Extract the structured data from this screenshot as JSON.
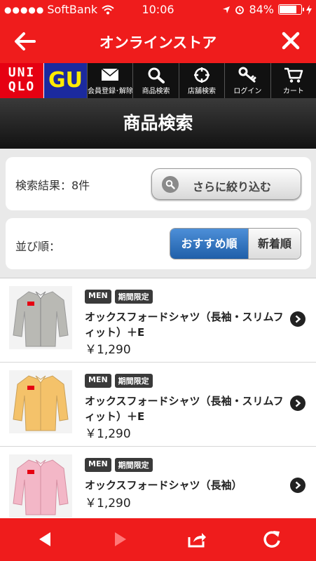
{
  "status": {
    "carrier": "SoftBank",
    "time": "10:06",
    "battery": "84%",
    "battery_level": 0.84
  },
  "nav": {
    "title": "オンラインストア"
  },
  "menubar": {
    "uniqlo_line1": "UNI",
    "uniqlo_line2": "QLO",
    "gu": "GU",
    "items": [
      {
        "label": "会員登録･解除",
        "icon": "mail-icon"
      },
      {
        "label": "商品検索",
        "icon": "search-icon"
      },
      {
        "label": "店舗検索",
        "icon": "crosshair-icon"
      },
      {
        "label": "ログイン",
        "icon": "key-icon"
      },
      {
        "label": "カート",
        "icon": "cart-icon"
      }
    ]
  },
  "page": {
    "title": "商品検索"
  },
  "results": {
    "text": "検索結果：8件",
    "refine_label": "さらに絞り込む"
  },
  "sort": {
    "label": "並び順：",
    "options": [
      {
        "label": "おすすめ順",
        "selected": true
      },
      {
        "label": "新着順",
        "selected": false
      }
    ]
  },
  "products": [
    {
      "tags": [
        "MEN",
        "期間限定"
      ],
      "name": "オックスフォードシャツ（長袖・スリムフィット）＋E",
      "price": "￥1,290",
      "color": "#b9b9b4"
    },
    {
      "tags": [
        "MEN",
        "期間限定"
      ],
      "name": "オックスフォードシャツ（長袖・スリムフィット）＋E",
      "price": "￥1,290",
      "color": "#f4c26a"
    },
    {
      "tags": [
        "MEN",
        "期間限定"
      ],
      "name": "オックスフォードシャツ（長袖）",
      "price": "￥1,290",
      "color": "#f3b7c7"
    }
  ],
  "colors": {
    "brand_red": "#ef1c1c",
    "selected_blue": "#2a6fbf"
  }
}
